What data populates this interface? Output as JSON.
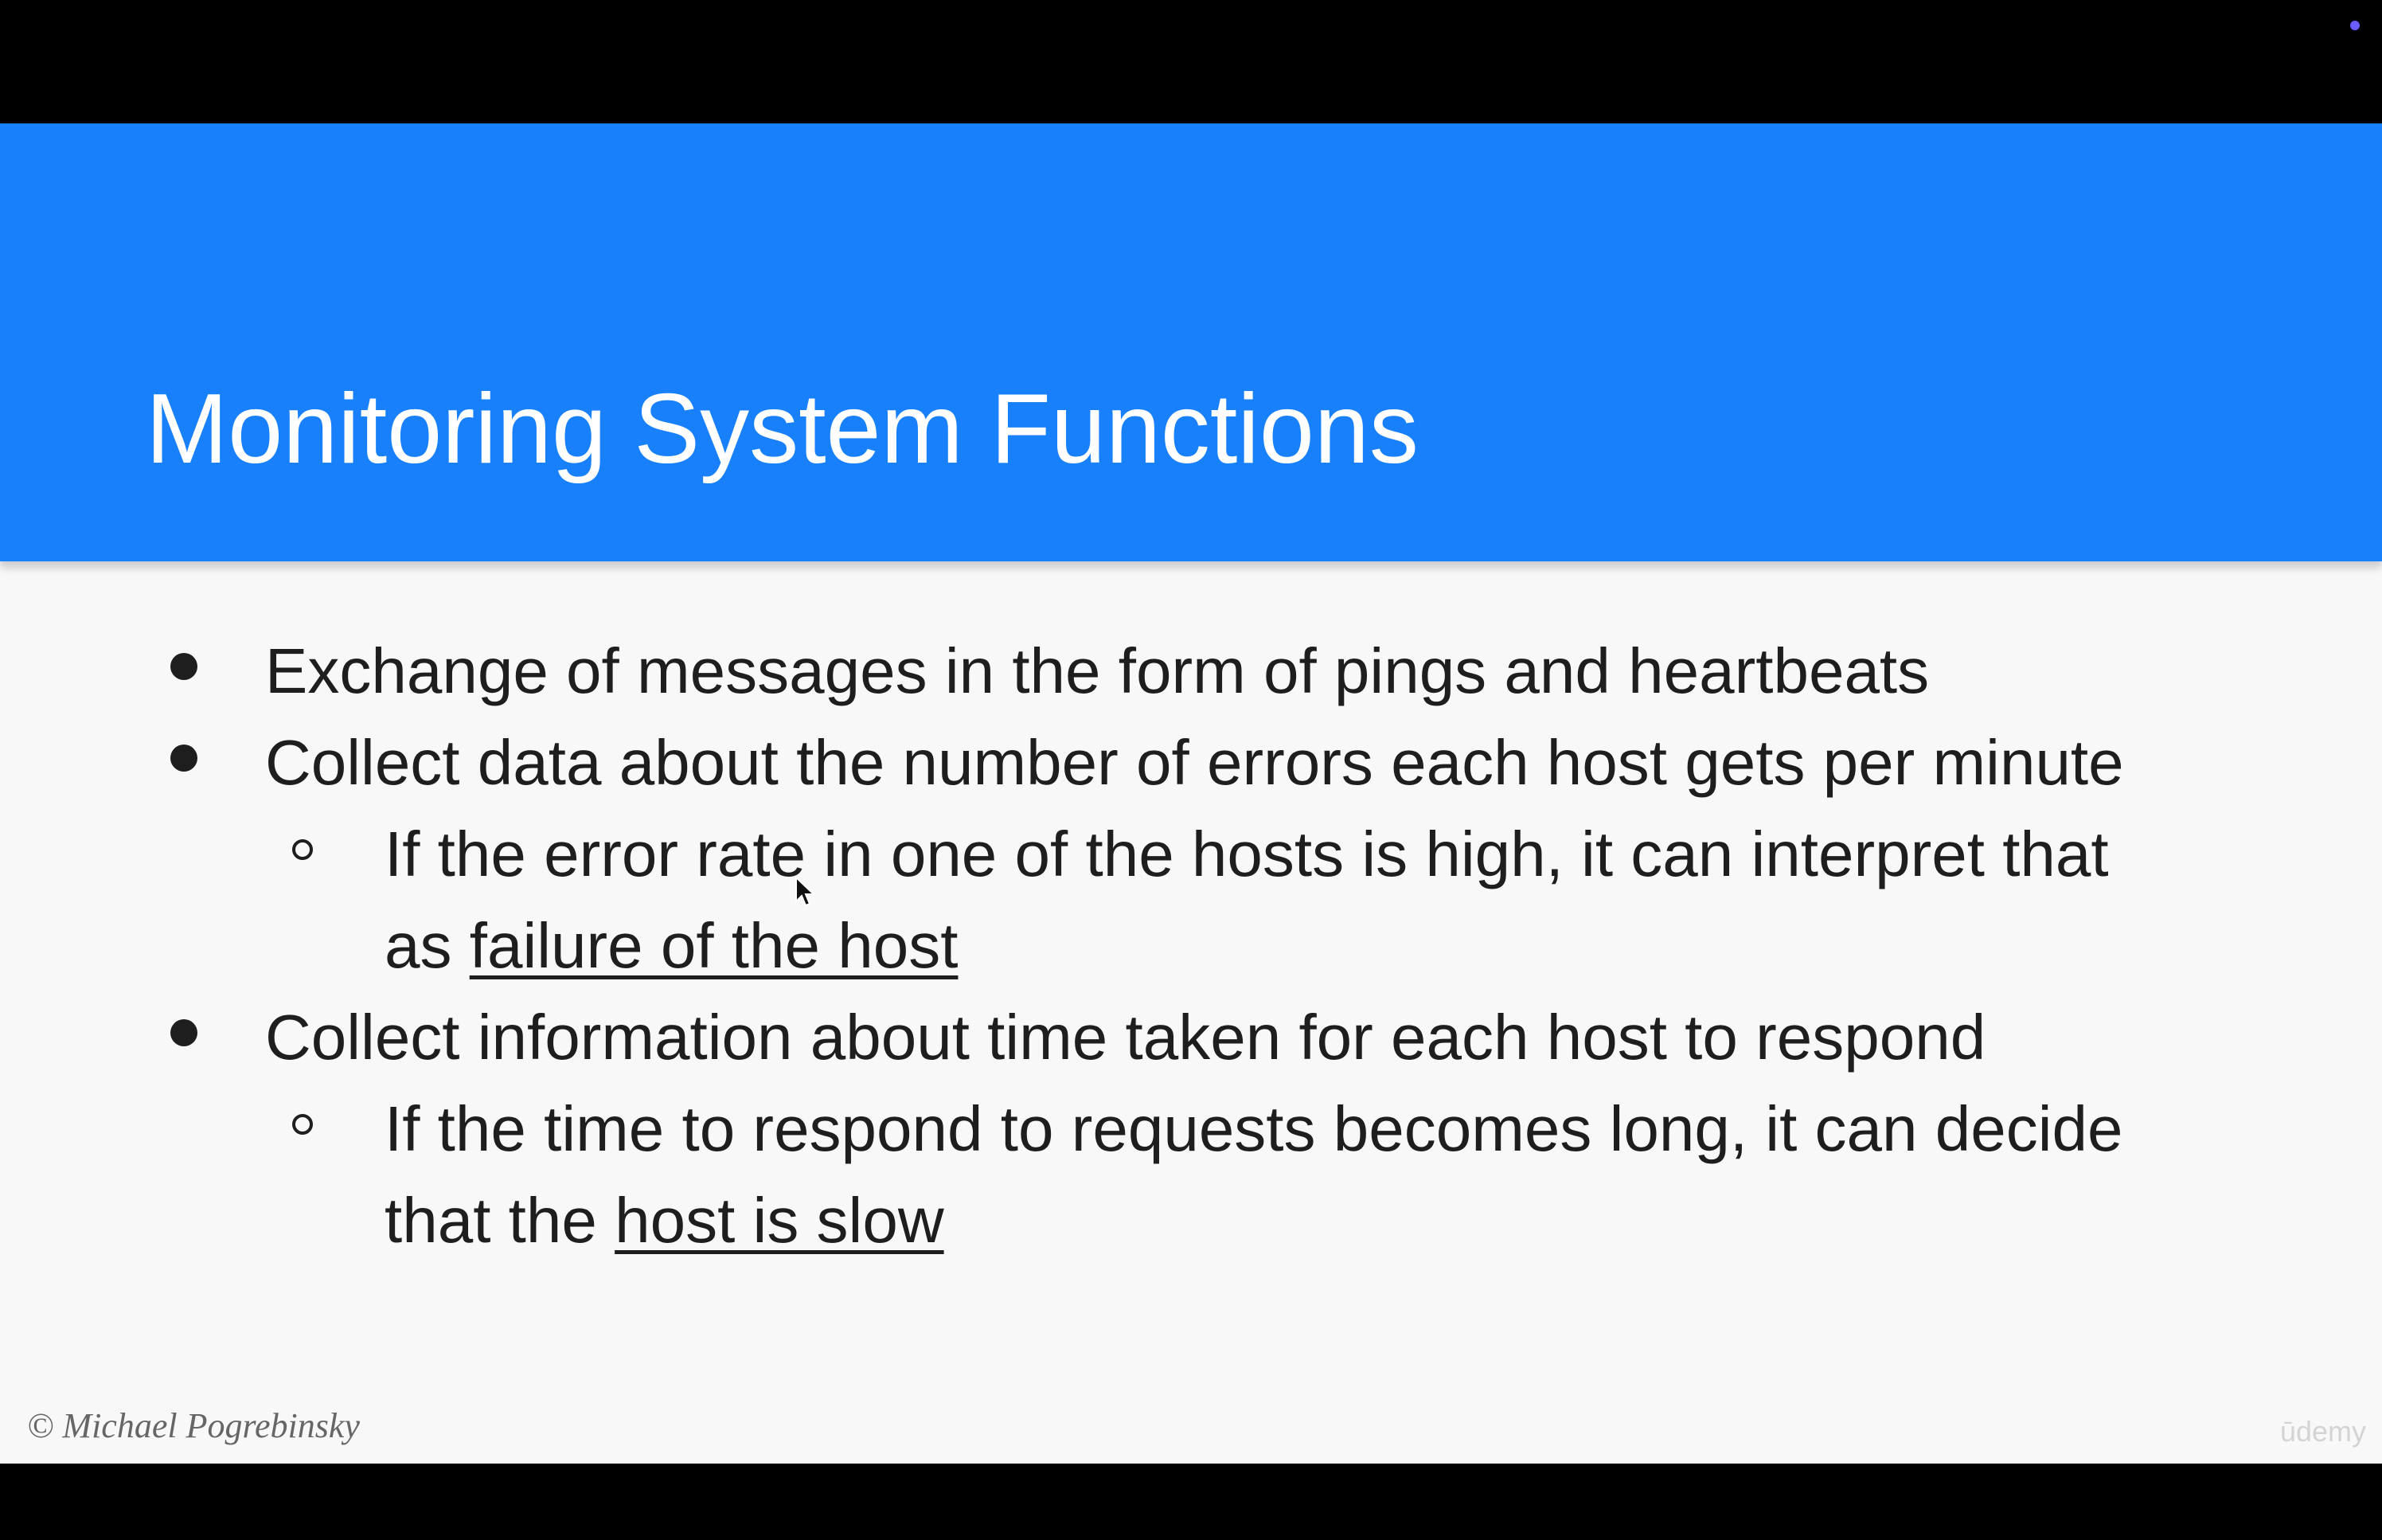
{
  "slide": {
    "title": "Monitoring System Functions",
    "bullets": [
      {
        "text": "Exchange of messages in the form of pings and heartbeats"
      },
      {
        "text": "Collect data about the number of errors each host gets per minute",
        "sub": {
          "line1": "If the error rate in one of the hosts is high, it can interpret that",
          "line2_prefix": "as ",
          "line2_underlined": "failure of the host"
        }
      },
      {
        "text": "Collect information about time taken for each host to respond",
        "sub": {
          "line1": "If the time to respond to requests becomes long, it can decide",
          "line2_prefix": "that the ",
          "line2_underlined": "host is slow"
        }
      }
    ],
    "copyright": "© Michael Pogrebinsky",
    "watermark": "ūdemy"
  },
  "colors": {
    "header_blue": "#1880fa",
    "slide_background": "#f8f8f8",
    "text": "#1e1e1e",
    "letterbox": "#000000"
  },
  "icons": [
    "bullet-disc-icon",
    "bullet-circle-icon",
    "mouse-pointer-icon",
    "status-dot-icon"
  ]
}
